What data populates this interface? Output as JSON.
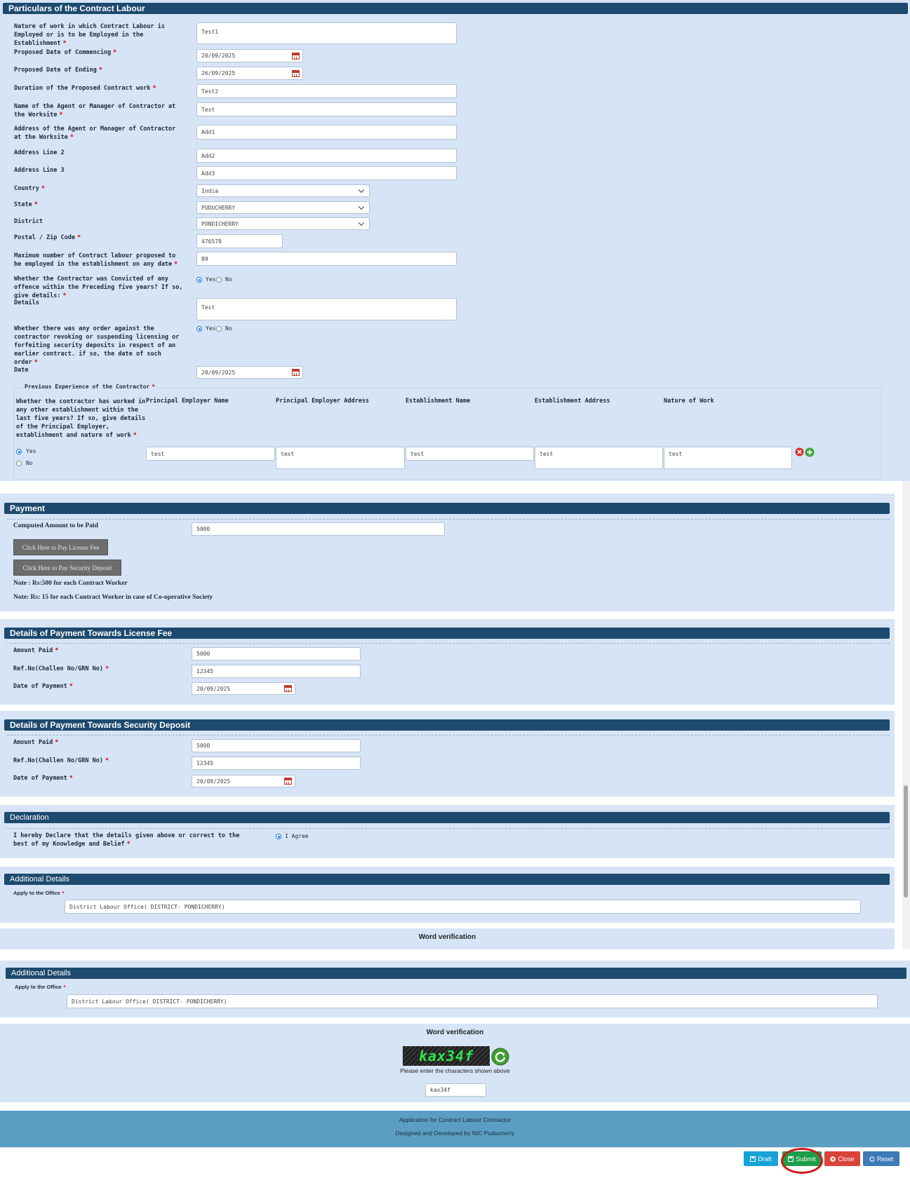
{
  "particulars": {
    "title": "Particulars of the Contract Labour",
    "nature_label": "Nature of work in which Contract Labour is Employed or is to be Employed in the Establishment",
    "nature_value": "Test1",
    "commence_label": "Proposed Date of Commencing",
    "commence_value": "20/09/2025",
    "ending_label": "Proposed Date of Ending",
    "ending_value": "26/09/2025",
    "duration_label": "Duration of the Proposed Contract work",
    "duration_value": "Test2",
    "agent_name_label": "Name of the Agent or Manager of Contractor at the Worksite",
    "agent_name_value": "Test",
    "agent_addr_label": "Address of the Agent or Manager of Contractor at the Worksite",
    "agent_addr_value": "Add1",
    "addr2_label": "Address Line 2",
    "addr2_value": "Add2",
    "addr3_label": "Address Line 3",
    "addr3_value": "Add3",
    "country_label": "Country",
    "country_value": "India",
    "state_label": "State",
    "state_value": "PUDUCHERRY",
    "district_label": "District",
    "district_value": "PONDICHERRY",
    "postal_label": "Postal / Zip Code",
    "postal_value": "476578",
    "max_label": "Maximum number of Contract labour proposed to be employed in the establishment on any date",
    "max_value": "89",
    "convicted_label": "Whether the Contractor was Convicted of any offence within the Preceding five years? If so, give details:",
    "yes": "Yes",
    "no": "No",
    "details_label": "Details",
    "details_value": "Test",
    "order_label": "Whether there was any order against the contractor revoking or suspending licensing or forfeiting security deposits in respect of an earlier contract. if so, the date of such order",
    "date_label": "Date",
    "date_value": "20/09/2025"
  },
  "experience": {
    "legend": "Previous Experience of the Contractor",
    "question": "Whether the contractor has worked in any other establishment within the last five years? If so, give details of the Principal Employer, establishment and nature of work",
    "columns": [
      "Principal Employer Name",
      "Principal Employer Address",
      "Establishment Name",
      "Establishment Address",
      "Nature of Work"
    ],
    "row": [
      "test",
      "test",
      "test",
      "test",
      "test"
    ],
    "yes": "Yes",
    "no": "No"
  },
  "payment": {
    "title": "Payment",
    "computed_label": "Computed Amount to be Paid",
    "computed_value": "5000",
    "license_btn": "Click Here to Pay License Fee",
    "security_btn": "Click Here to Pay Security Deposit",
    "note1": "Note : Rs:500 for each Contract Worker",
    "note2": "Note: Rs: 15 for each Contract Worker in case of Co-operative Society"
  },
  "license_fee": {
    "title": "Details of Payment Towards License Fee",
    "amount_label": "Amount Paid",
    "amount_value": "5000",
    "ref_label": "Ref.No(Challen No/GRN No)",
    "ref_value": "12345",
    "date_label": "Date of Payment",
    "date_value": "20/09/2025"
  },
  "security": {
    "title": "Details of Payment Towards Security Deposit",
    "amount_label": "Amount Paid",
    "amount_value": "5000",
    "ref_label": "Ref.No(Challen No/GRN No)",
    "ref_value": "12345",
    "date_label": "Date of Payment",
    "date_value": "20/09/2025"
  },
  "declaration": {
    "title": "Declaration",
    "text": "I hereby Declare that the details given above or correct to the best of my Knowledge and Belief",
    "agree": "I Agree"
  },
  "additional": {
    "title": "Additional Details",
    "office_label": "Apply to the Office",
    "office_value": "District Labour Office( DISTRICT- PONDICHERRY)"
  },
  "verification": {
    "title": "Word verification",
    "captcha": "kax34f",
    "hint": "Please enter the characters shown above",
    "input_value": "kax34f"
  },
  "footer": {
    "line1": "Application for Contract Labour Contractor",
    "line2": "Designed and Developed by NIC Puducherry"
  },
  "actions": {
    "draft": "Draft",
    "submit": "Submit",
    "close": "Close",
    "reset": "Reset"
  },
  "colors": {
    "panel_bg": "#d6e4f5",
    "header_bg": "#1d4a6e",
    "footer_bg": "#5b9ec4",
    "draft": "#17a2d8",
    "submit": "#1e9e4a",
    "close": "#d9433a",
    "reset": "#3c7ab8"
  }
}
